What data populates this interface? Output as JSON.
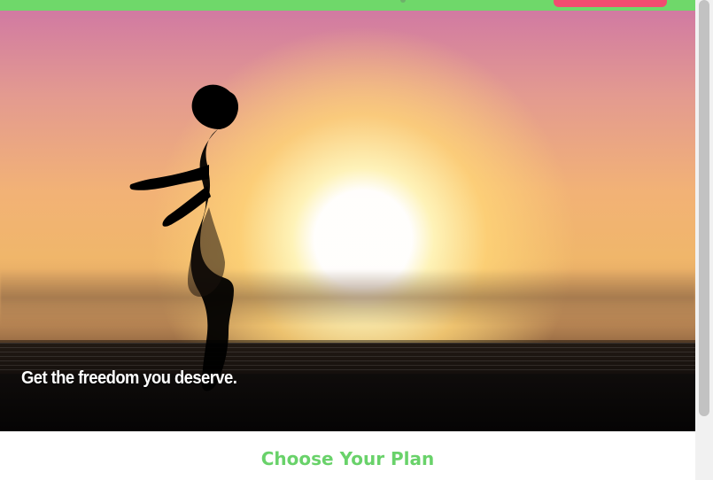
{
  "hero": {
    "caption": "Get the freedom you deserve."
  },
  "section": {
    "title": "Choose Your Plan"
  },
  "theme": {
    "accent_green": "#69d26a",
    "cta_pink": "#f24c70"
  }
}
